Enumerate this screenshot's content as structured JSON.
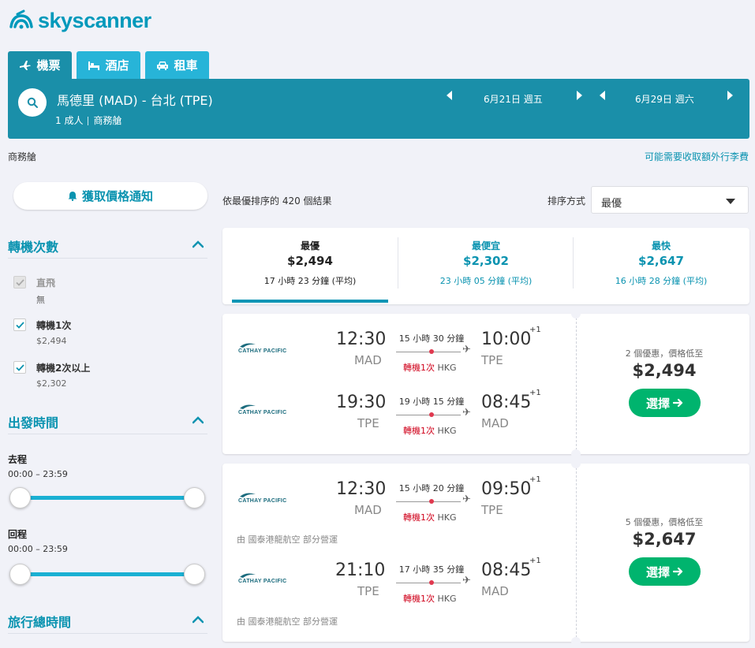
{
  "brand": {
    "name": "skyscanner",
    "color": "#0099bb"
  },
  "tabs": [
    {
      "label": "機票",
      "icon": "plane-icon",
      "active": true
    },
    {
      "label": "酒店",
      "icon": "bed-icon",
      "active": false
    },
    {
      "label": "租車",
      "icon": "car-icon",
      "active": false
    }
  ],
  "search": {
    "route": "馬德里 (MAD) - 台北 (TPE)",
    "passengers": "1 成人",
    "cabin": "商務艙",
    "depart_date": "6月21日 週五",
    "return_date": "6月29日 週六"
  },
  "cabin_note": "商務艙",
  "baggage_link": "可能需要收取額外行李費",
  "sidebar": {
    "alert_button": "獲取價格通知",
    "stops_title": "轉機次數",
    "stops": [
      {
        "label": "直飛",
        "sub": "無",
        "checked": true,
        "disabled": true
      },
      {
        "label": "轉機1次",
        "sub": "$2,494",
        "checked": true,
        "disabled": false
      },
      {
        "label": "轉機2次以上",
        "sub": "$2,302",
        "checked": true,
        "disabled": false
      }
    ],
    "depart_time_title": "出發時間",
    "outbound_label": "去程",
    "outbound_range": "00:00 – 23:59",
    "return_label": "回程",
    "return_range": "00:00 – 23:59",
    "duration_title": "旅行總時間"
  },
  "results": {
    "count_text": "依最優排序的 420 個結果",
    "sort_label": "排序方式",
    "sort_value": "最優"
  },
  "sort_tabs": [
    {
      "title": "最優",
      "price": "$2,494",
      "duration": "17 小時 23 分鐘 (平均)"
    },
    {
      "title": "最便宜",
      "price": "$2,302",
      "duration": "23 小時 05 分鐘 (平均)"
    },
    {
      "title": "最快",
      "price": "$2,647",
      "duration": "16 小時 28 分鐘 (平均)"
    }
  ],
  "cards": [
    {
      "legs": [
        {
          "airline": "CATHAY PACIFIC",
          "dep_time": "12:30",
          "dep_airport": "MAD",
          "duration": "15 小時 30 分鐘",
          "stops": "轉機1次",
          "hub": "HKG",
          "arr_time": "10:00",
          "arr_airport": "TPE",
          "day_offset": "+1",
          "operated_by": ""
        },
        {
          "airline": "CATHAY PACIFIC",
          "dep_time": "19:30",
          "dep_airport": "TPE",
          "duration": "19 小時 15 分鐘",
          "stops": "轉機1次",
          "hub": "HKG",
          "arr_time": "08:45",
          "arr_airport": "MAD",
          "day_offset": "+1",
          "operated_by": ""
        }
      ],
      "deals": "2 個優惠，價格低至",
      "price": "$2,494",
      "button": "選擇"
    },
    {
      "legs": [
        {
          "airline": "CATHAY PACIFIC",
          "dep_time": "12:30",
          "dep_airport": "MAD",
          "duration": "15 小時 20 分鐘",
          "stops": "轉機1次",
          "hub": "HKG",
          "arr_time": "09:50",
          "arr_airport": "TPE",
          "day_offset": "+1",
          "operated_by": "由 國泰港龍航空 部分營運"
        },
        {
          "airline": "CATHAY PACIFIC",
          "dep_time": "21:10",
          "dep_airport": "TPE",
          "duration": "17 小時 35 分鐘",
          "stops": "轉機1次",
          "hub": "HKG",
          "arr_time": "08:45",
          "arr_airport": "MAD",
          "day_offset": "+1",
          "operated_by": "由 國泰港龍航空 部分營運"
        }
      ],
      "deals": "5 個優惠，價格低至",
      "price": "$2,647",
      "button": "選擇"
    }
  ]
}
